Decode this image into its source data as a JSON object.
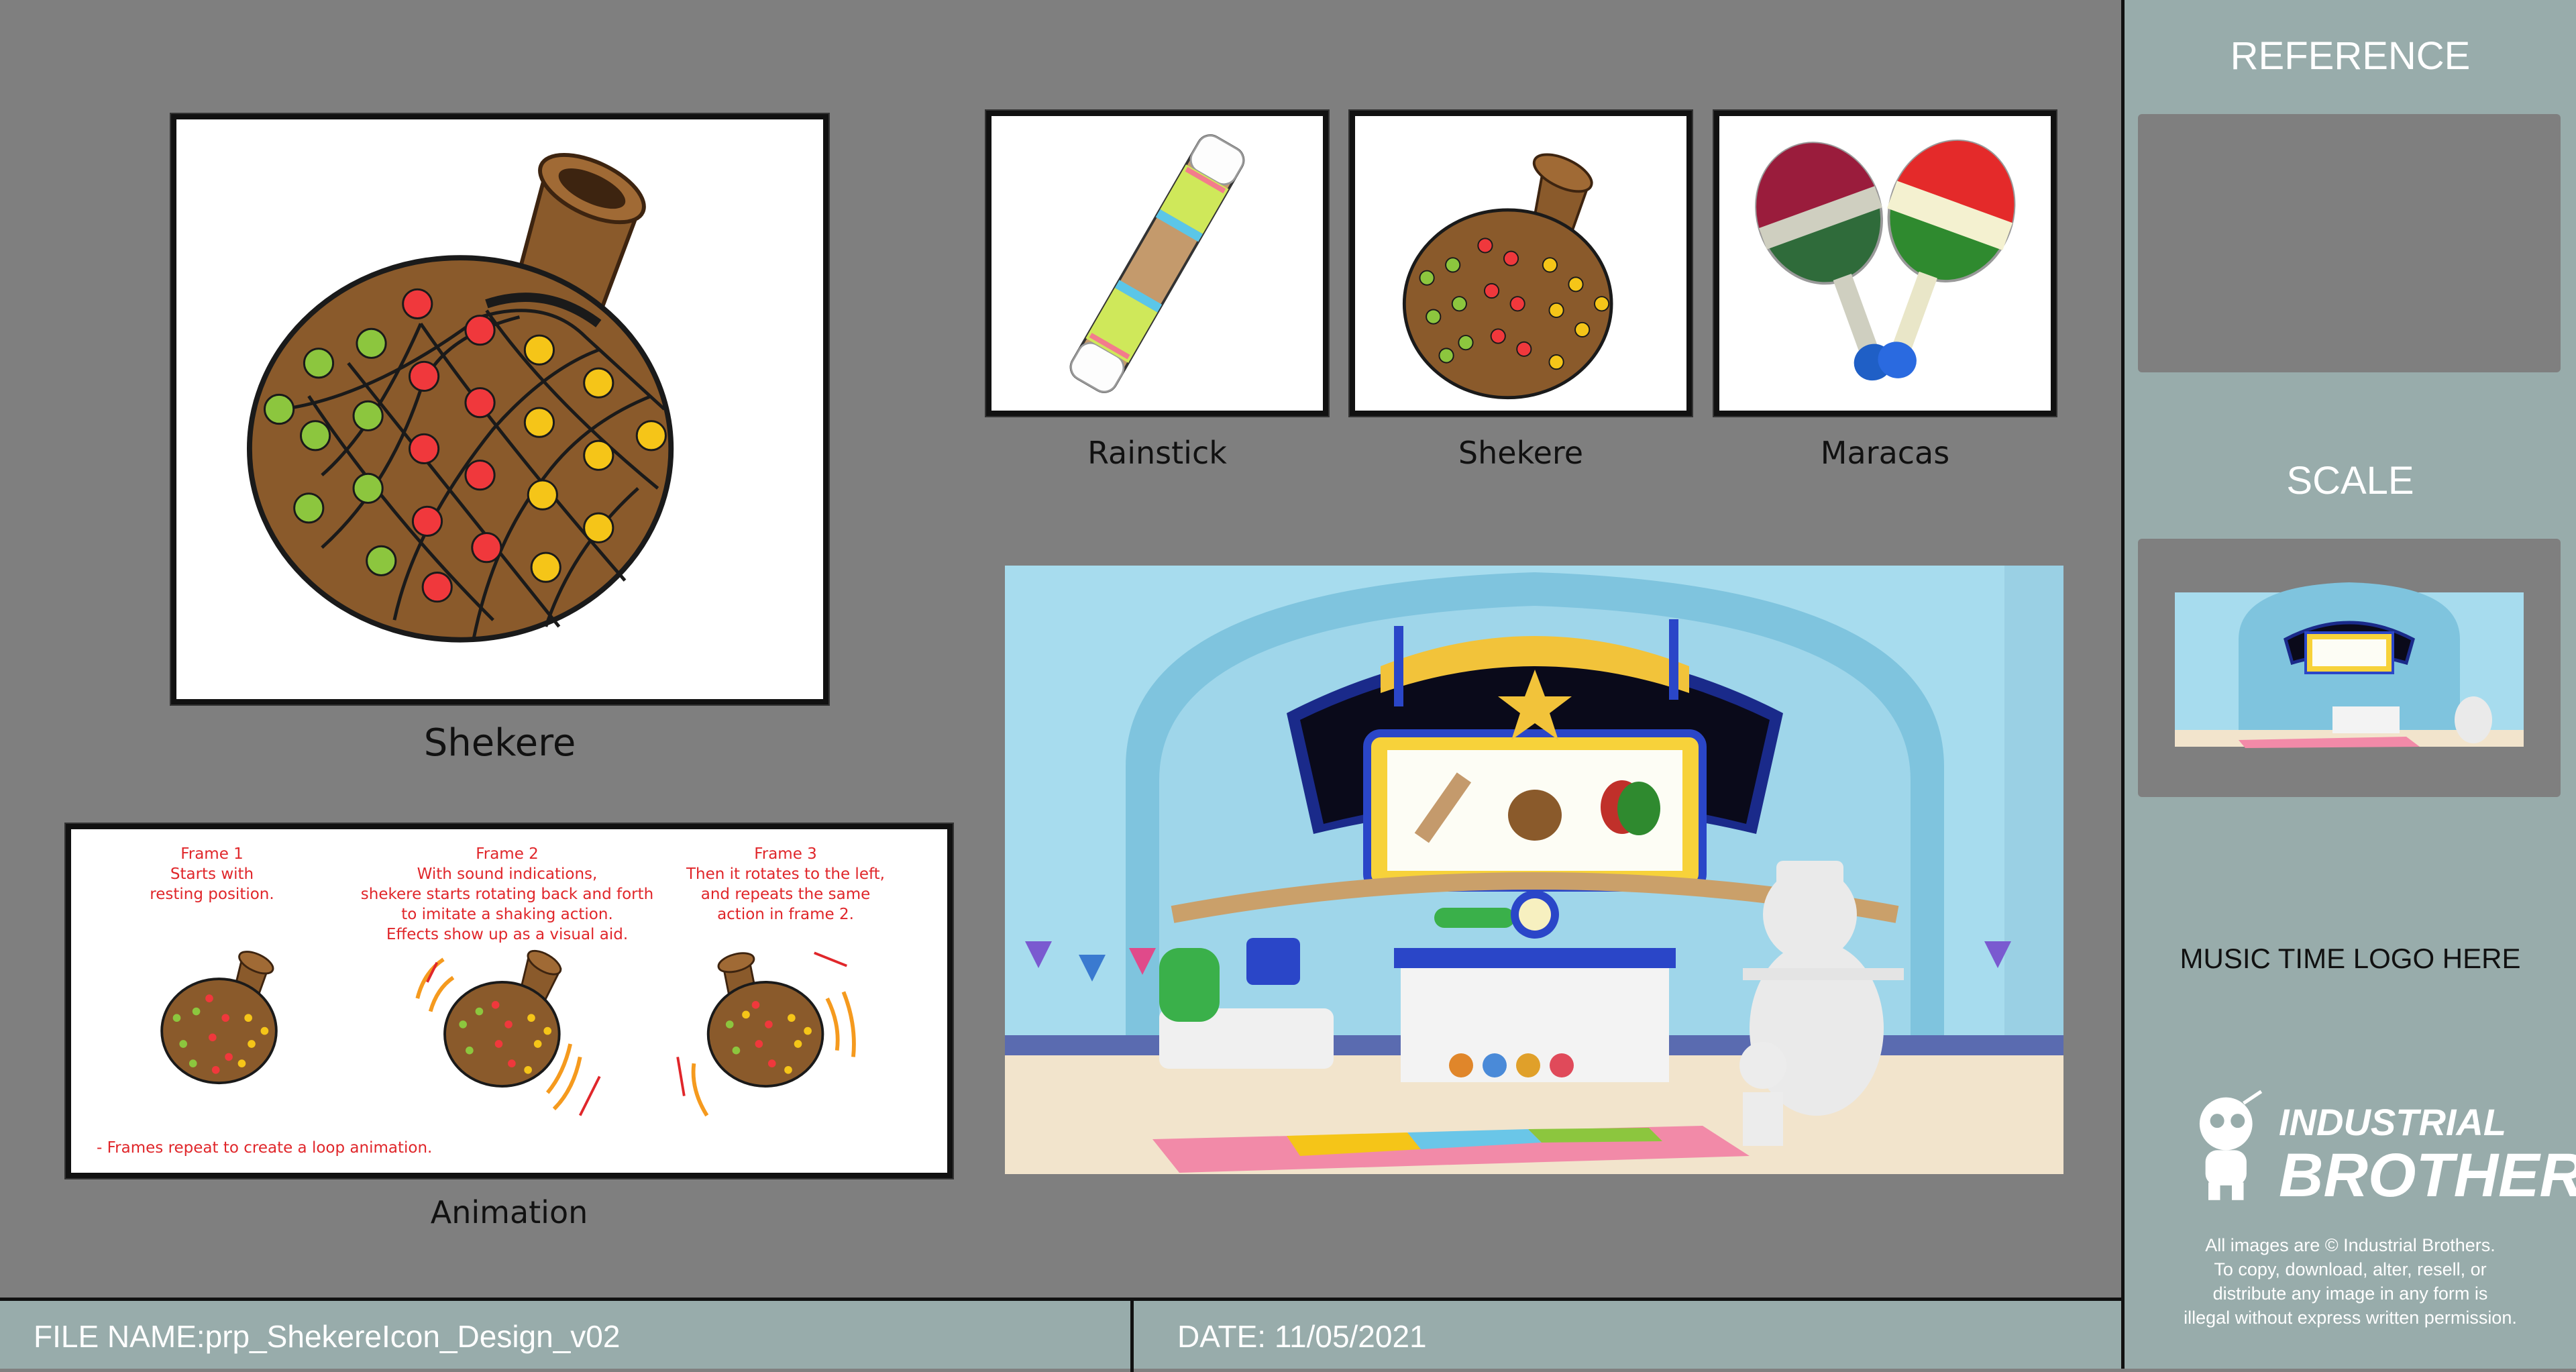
{
  "main_panel": {
    "caption": "Shekere"
  },
  "thumbnails": [
    {
      "caption": "Rainstick"
    },
    {
      "caption": "Shekere"
    },
    {
      "caption": "Maracas"
    }
  ],
  "animation": {
    "caption": "Animation",
    "frame1": {
      "title": "Frame 1",
      "lines": [
        "Starts with",
        "resting position."
      ]
    },
    "frame2": {
      "title": "Frame 2",
      "lines": [
        "With sound indications,",
        "shekere starts rotating back and forth",
        "to imitate a shaking action.",
        "Effects show up as a visual aid."
      ]
    },
    "frame3": {
      "title": "Frame 3",
      "lines": [
        "Then it rotates to the left,",
        "and repeats the same",
        "action in frame 2."
      ]
    },
    "note": "- Frames repeat to create a loop animation."
  },
  "sidebar": {
    "reference_title": "REFERENCE",
    "scale_title": "SCALE",
    "logo_placeholder": "MUSIC TIME LOGO HERE",
    "brand_line1": "INDUSTRIAL",
    "brand_line2": "BROTHERS",
    "copyright": [
      "All images are © Industrial Brothers.",
      "To copy, download, alter, resell, or",
      "distribute any image in any form is",
      "illegal without express written permission."
    ]
  },
  "footer": {
    "file_label": "FILE NAME:",
    "file_value": "prp_ShekereIcon_Design_v02",
    "date_label": "DATE: ",
    "date_value": "11/05/2021"
  },
  "colors": {
    "background": "#7f7f7f",
    "sidebar": "#98acab",
    "bead_red": "#f0383c",
    "bead_green": "#8cc63e",
    "bead_yellow": "#f5c518",
    "gourd_brown": "#8a5a2b",
    "annotation_red": "#e0262a"
  }
}
